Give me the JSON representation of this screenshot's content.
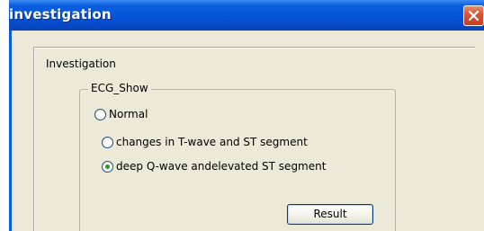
{
  "window": {
    "title": "investigation",
    "close_icon": "close-x-icon",
    "titlebar_color": "#0653d8",
    "close_color": "#d9512e"
  },
  "panel": {
    "label": "Investigation"
  },
  "ecg_group": {
    "legend": "ECG_Show",
    "options": [
      {
        "label": "Normal",
        "checked": false
      },
      {
        "label": "changes in T-wave and ST segment",
        "checked": false
      },
      {
        "label": "deep Q-wave andelevated ST segment",
        "checked": true
      }
    ]
  },
  "actions": {
    "result_label": "Result"
  }
}
